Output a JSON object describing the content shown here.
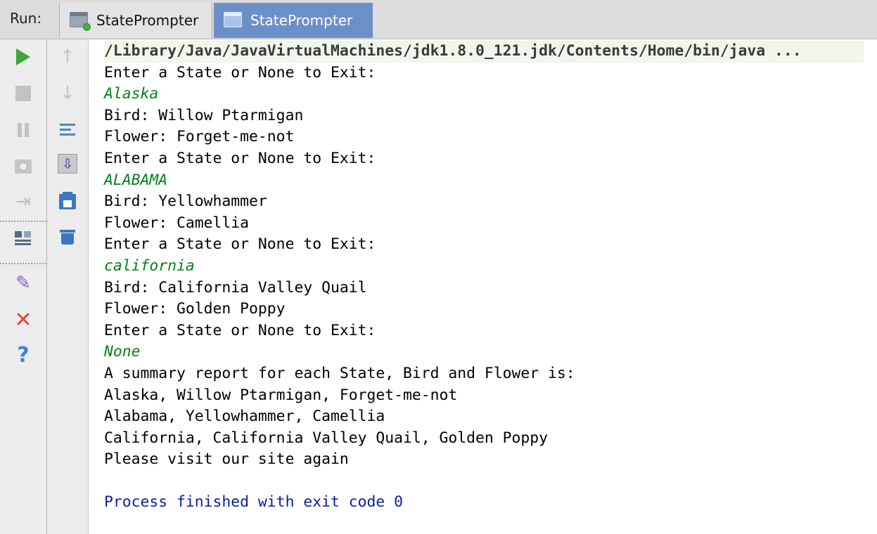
{
  "run_panel": {
    "label": "Run:",
    "tabs": [
      {
        "label": "StatePrompter",
        "active": false
      },
      {
        "label": "StatePrompter",
        "active": true
      }
    ]
  },
  "toolbar_primary": [
    {
      "icon": "rerun-play-icon",
      "color": "#3fa535"
    },
    {
      "icon": "stop-icon"
    },
    {
      "icon": "pause-icon"
    },
    {
      "icon": "dump-threads-camera-icon"
    },
    {
      "icon": "exit-arrow-icon"
    },
    {
      "icon": "restore-layout-icon"
    },
    {
      "icon": "pin-tab-icon"
    },
    {
      "icon": "close-icon",
      "color": "#e0483a"
    },
    {
      "icon": "help-icon",
      "color": "#3c86d6"
    }
  ],
  "toolbar_secondary": [
    {
      "icon": "up-arrow-icon"
    },
    {
      "icon": "down-arrow-icon"
    },
    {
      "icon": "soft-wrap-icon"
    },
    {
      "icon": "scroll-to-end-icon"
    },
    {
      "icon": "print-icon"
    },
    {
      "icon": "clear-all-trash-icon"
    }
  ],
  "console": {
    "command": "/Library/Java/JavaVirtualMachines/jdk1.8.0_121.jdk/Contents/Home/bin/java ...",
    "lines": [
      {
        "type": "output",
        "text": "Enter a State or None to Exit:"
      },
      {
        "type": "input",
        "text": "Alaska"
      },
      {
        "type": "output",
        "text": "Bird: Willow Ptarmigan"
      },
      {
        "type": "output",
        "text": "Flower: Forget-me-not"
      },
      {
        "type": "output",
        "text": "Enter a State or None to Exit:"
      },
      {
        "type": "input",
        "text": "ALABAMA"
      },
      {
        "type": "output",
        "text": "Bird: Yellowhammer"
      },
      {
        "type": "output",
        "text": "Flower: Camellia"
      },
      {
        "type": "output",
        "text": "Enter a State or None to Exit:"
      },
      {
        "type": "input",
        "text": "california"
      },
      {
        "type": "output",
        "text": "Bird: California Valley Quail"
      },
      {
        "type": "output",
        "text": "Flower: Golden Poppy"
      },
      {
        "type": "output",
        "text": "Enter a State or None to Exit:"
      },
      {
        "type": "input",
        "text": "None"
      },
      {
        "type": "output",
        "text": "A summary report for each State, Bird and Flower is:"
      },
      {
        "type": "output",
        "text": "Alaska, Willow Ptarmigan, Forget-me-not"
      },
      {
        "type": "output",
        "text": "Alabama, Yellowhammer, Camellia"
      },
      {
        "type": "output",
        "text": "California, California Valley Quail, Golden Poppy"
      },
      {
        "type": "output",
        "text": "Please visit our site again"
      }
    ],
    "process_status": "Process finished with exit code 0"
  },
  "colors": {
    "input_text": "#00821c",
    "process_text": "#0a1fa0",
    "active_tab": "#6b8fc9"
  }
}
